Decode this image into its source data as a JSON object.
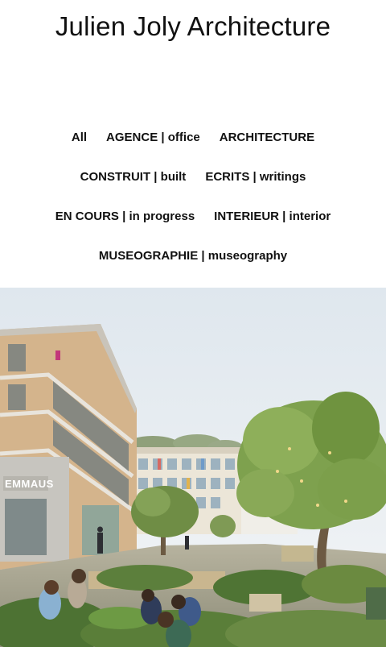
{
  "site": {
    "title": "Julien Joly Architecture"
  },
  "filters": {
    "rows": [
      [
        "All",
        "AGENCE | office",
        "ARCHITECTURE"
      ],
      [
        "CONSTRUIT | built",
        "ECRITS | writings"
      ],
      [
        "EN COURS | in progress",
        "INTERIEUR | interior"
      ],
      [
        "MUSEOGRAPHIE | museography"
      ]
    ]
  },
  "hero": {
    "sign_text": "EMMAUS"
  },
  "colors": {
    "text": "#111111",
    "background": "#ffffff",
    "sky": "#e9eef2"
  }
}
